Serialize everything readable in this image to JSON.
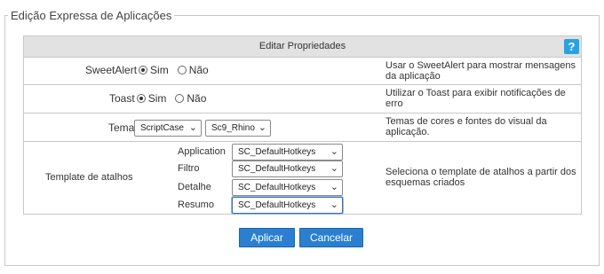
{
  "fieldset_title": "Edição Expressa de Aplicações",
  "panel": {
    "header": "Editar Propriedades",
    "help_label": "?"
  },
  "rows": {
    "sweetalert": {
      "label": "SweetAlert",
      "options": [
        "Sim",
        "Não"
      ],
      "selected": "Sim",
      "description": "Usar o SweetAlert para mostrar mensagens da aplicação"
    },
    "toast": {
      "label": "Toast",
      "options": [
        "Sim",
        "Não"
      ],
      "selected": "Sim",
      "description": "Utilizar o Toast para exibir notificações de erro"
    },
    "tema": {
      "label": "Tema",
      "select1": "ScriptCase",
      "select2": "Sc9_Rhino",
      "description": "Temas de cores e fontes do visual da aplicação."
    },
    "template": {
      "label": "Template de atalhos",
      "fields": [
        {
          "label": "Application",
          "value": "SC_DefaultHotkeys"
        },
        {
          "label": "Filtro",
          "value": "SC_DefaultHotkeys"
        },
        {
          "label": "Detalhe",
          "value": "SC_DefaultHotkeys"
        },
        {
          "label": "Resumo",
          "value": "SC_DefaultHotkeys"
        }
      ],
      "description": "Seleciona o template de atalhos a partir dos esquemas criados"
    }
  },
  "buttons": {
    "apply": "Aplicar",
    "cancel": "Cancelar"
  },
  "colors": {
    "button_bg": "#2a7fd0",
    "help_bg": "#27a3e0",
    "header_bg": "#e2e2e2"
  }
}
